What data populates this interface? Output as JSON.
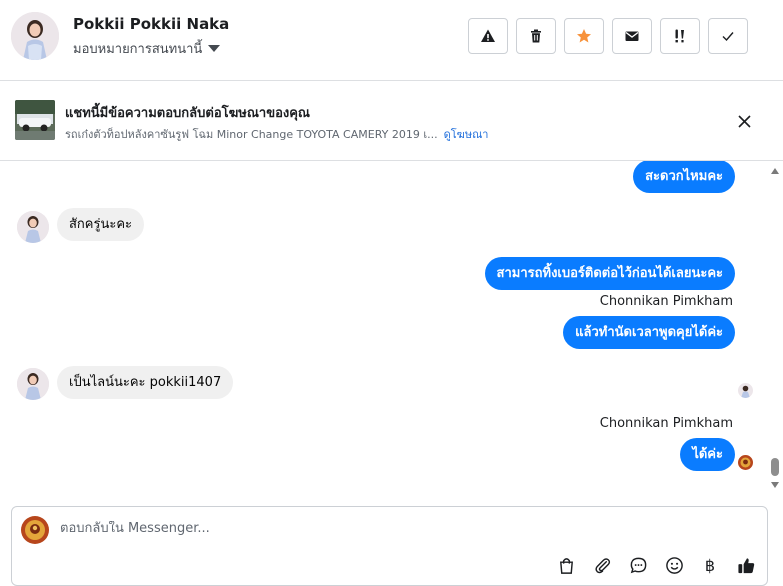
{
  "header": {
    "contact_name": "Pokkii Pokkii Naka",
    "assign_label": "มอบหมายการสนทนานี้",
    "actions": [
      "warning-icon",
      "trash-icon",
      "star-icon",
      "envelope-icon",
      "follow-up-icon",
      "check-icon"
    ],
    "star_color": "#f7923b"
  },
  "ad": {
    "title": "แชทนี้มีข้อความตอบกลับต่อโฆษณาของคุณ",
    "subtitle": "รถเก๋งตัวท็อปหลังคาซันรูฟ โฉม Minor Change TOYOTA CAMERY 2019 เ...",
    "link": "ดูโฆษณา"
  },
  "messages": [
    {
      "direction": "out",
      "text": "สะดวกไหมคะ"
    },
    {
      "direction": "in",
      "text": "สักครู่นะคะ"
    },
    {
      "direction": "out",
      "text": "สามารถทิ้งเบอร์ติดต่อไว้ก่อนได้เลยนะคะ"
    },
    {
      "direction": "sender",
      "text": "Chonnikan Pimkham"
    },
    {
      "direction": "out",
      "text": "แล้วทำนัดเวลาพูดคุยได้ค่ะ"
    },
    {
      "direction": "in",
      "text": "เป็นไลน์นะคะ pokkii1407"
    },
    {
      "direction": "sender",
      "text": "Chonnikan Pimkham"
    },
    {
      "direction": "out",
      "text": "ได้ค่ะ"
    }
  ],
  "composer": {
    "placeholder": "ตอบกลับใน Messenger...",
    "tools": [
      "shopping-bag-icon",
      "paperclip-icon",
      "saved-reply-icon",
      "emoji-icon",
      "baht-icon",
      "thumbs-up-icon"
    ],
    "baht_symbol": "฿"
  },
  "colors": {
    "outgoing_bubble": "#0a7cff",
    "incoming_bubble": "#f0f0f0",
    "link": "#216fdb"
  }
}
